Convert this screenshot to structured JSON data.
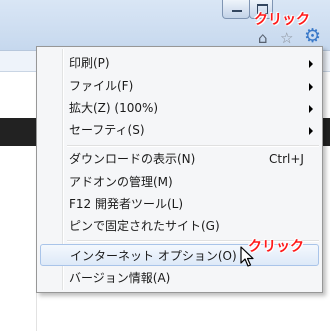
{
  "annotations": {
    "top": "クリック",
    "mid": "クリック"
  },
  "toolbar": {
    "home_icon": "home-icon",
    "star_icon": "star-icon",
    "gear_icon": "gear-icon"
  },
  "menu": {
    "items": [
      {
        "label": "印刷(P)",
        "submenu": true
      },
      {
        "label": "ファイル(F)",
        "submenu": true
      },
      {
        "label": "拡大(Z) (100%)",
        "submenu": true
      },
      {
        "label": "セーフティ(S)",
        "submenu": true
      },
      {
        "label": "ダウンロードの表示(N)",
        "shortcut": "Ctrl+J"
      },
      {
        "label": "アドオンの管理(M)"
      },
      {
        "label": "F12 開発者ツール(L)"
      },
      {
        "label": "ピンで固定されたサイト(G)"
      },
      {
        "label": "インターネット オプション(O)",
        "highlighted": true
      },
      {
        "label": "バージョン情報(A)"
      }
    ]
  }
}
